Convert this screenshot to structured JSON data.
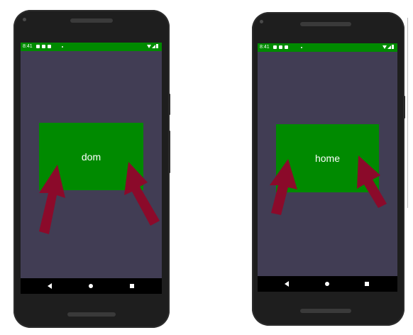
{
  "colors": {
    "status_bar": "#008a00",
    "screen_background": "#413d54",
    "button": "#008a00",
    "arrow": "#8b0a2a",
    "nav_bar": "#000000",
    "phone_frame": "#1e1e1e"
  },
  "phones": [
    {
      "status_bar": {
        "time": "8:41"
      },
      "button": {
        "label": "dom"
      },
      "nav": {
        "back_icon": "back-triangle-icon",
        "home_icon": "home-circle-icon",
        "recents_icon": "recents-square-icon"
      }
    },
    {
      "status_bar": {
        "time": "8:41"
      },
      "button": {
        "label": "home"
      },
      "nav": {
        "back_icon": "back-triangle-icon",
        "home_icon": "home-circle-icon",
        "recents_icon": "recents-square-icon"
      }
    }
  ]
}
